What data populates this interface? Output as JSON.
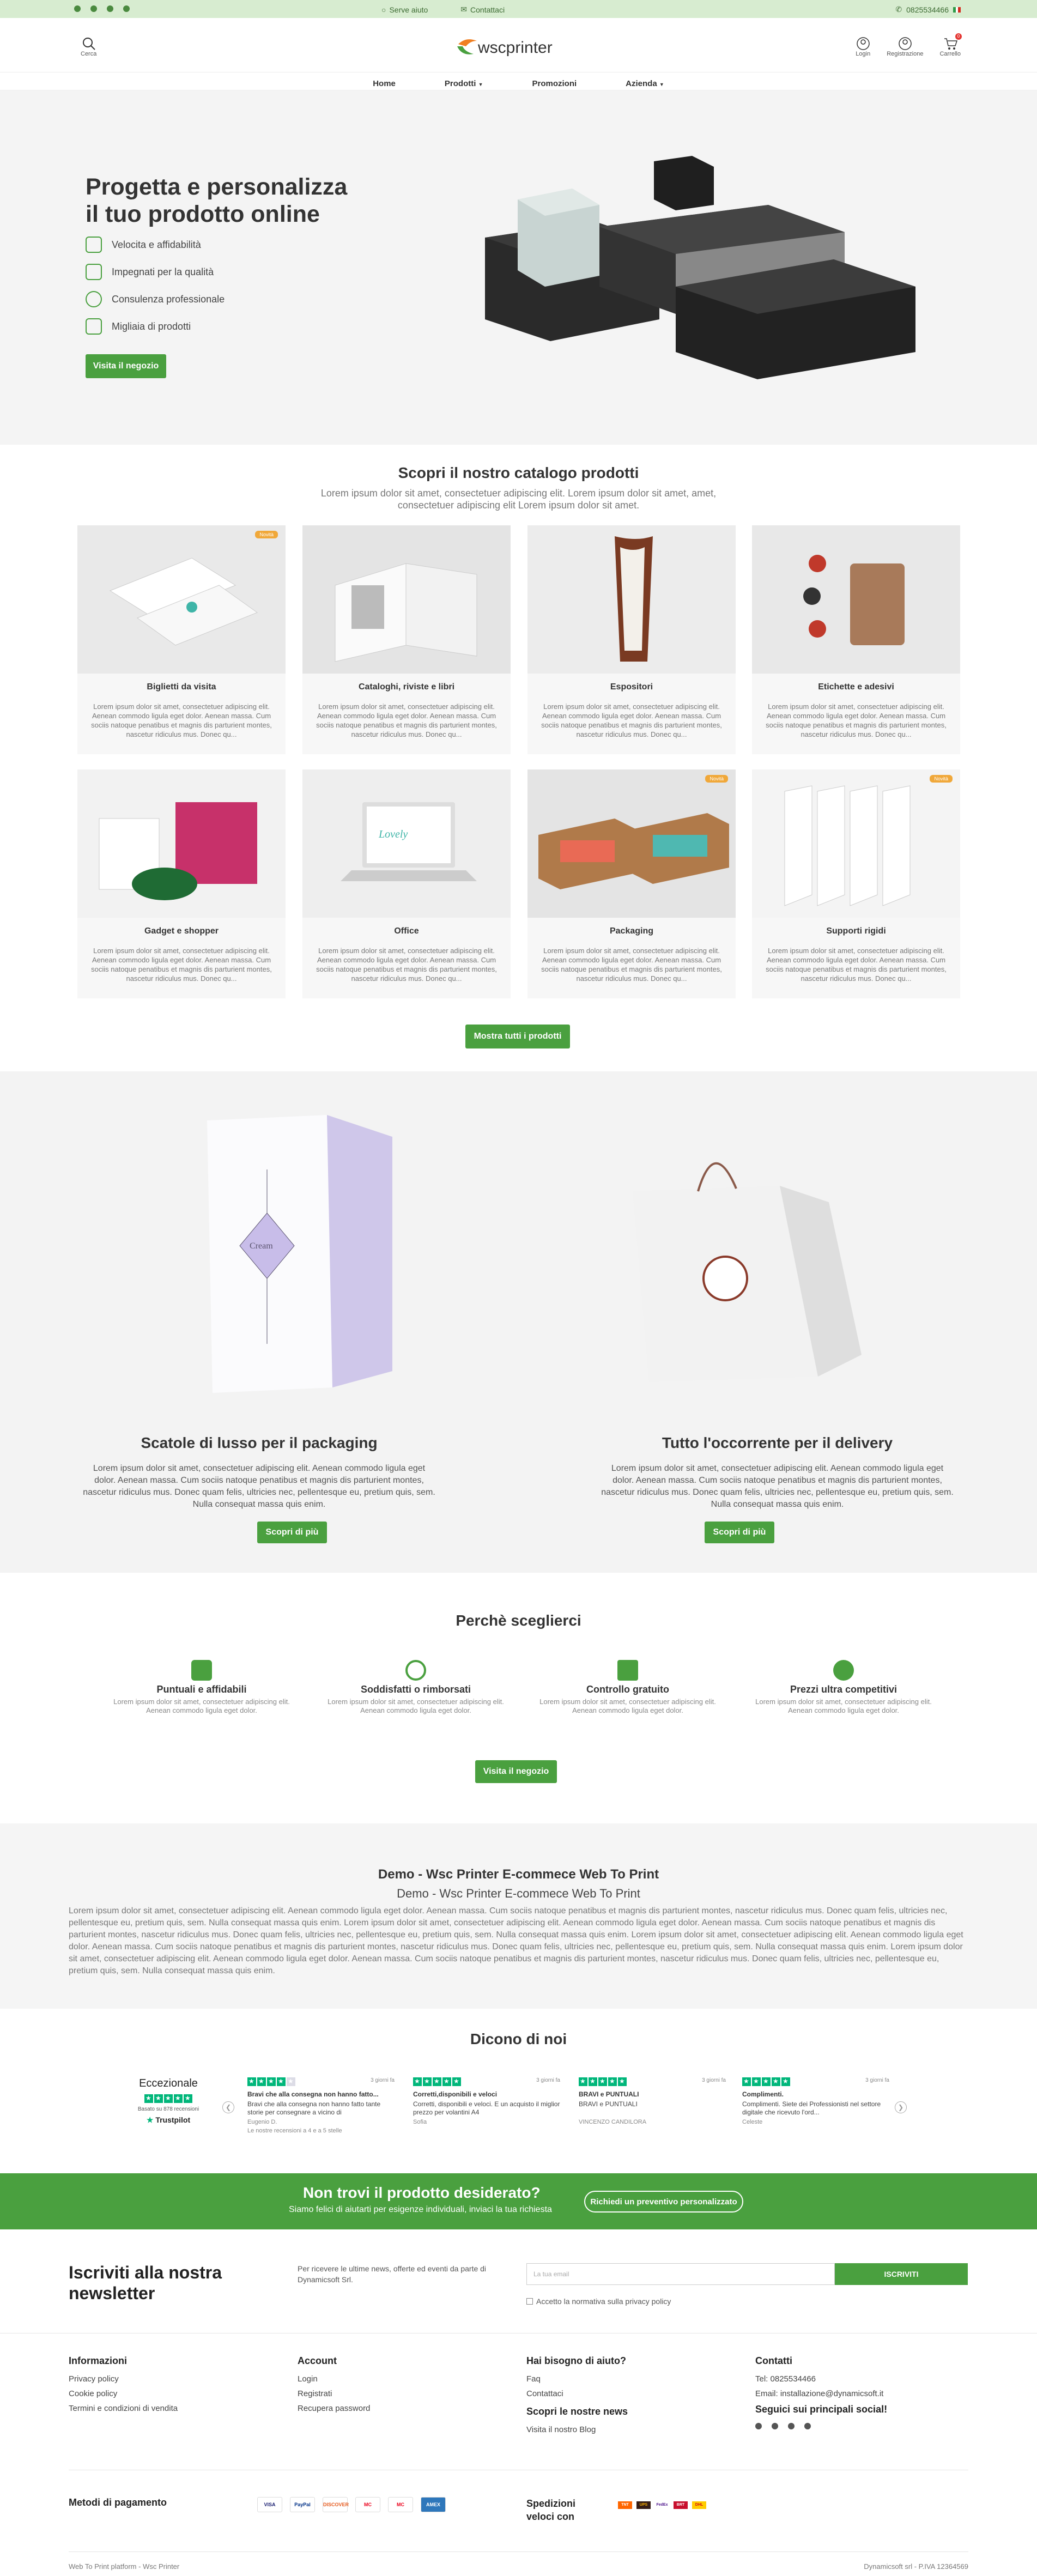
{
  "topbar": {
    "help": "Serve aiuto",
    "contacts": "Contattaci",
    "phone": "0825534466"
  },
  "header": {
    "search_label": "Cerca",
    "logo_text": "wscprinter",
    "login": "Login",
    "register": "Registrazione",
    "cart": "Carrello",
    "cart_count": "0"
  },
  "nav": [
    "Home",
    "Prodotti",
    "Promozioni",
    "Azienda"
  ],
  "hero": {
    "title_1": "Progetta e personalizza",
    "title_2": "il tuo prodotto online",
    "features": [
      "Velocita e affidabilità",
      "Impegnati per la qualità",
      "Consulenza professionale",
      "Migliaia di prodotti"
    ],
    "button": "Visita il negozio"
  },
  "catalog": {
    "title": "Scopri il nostro catalogo prodotti",
    "subtitle": "Lorem ipsum dolor sit amet, consectetuer adipiscing elit. Lorem ipsum dolor sit amet, amet, consectetuer adipiscing elit Lorem ipsum dolor sit amet.",
    "card_text": "Lorem ipsum dolor sit amet, consectetuer adipiscing elit. Aenean commodo ligula eget dolor. Aenean massa. Cum sociis natoque penatibus et magnis dis parturient montes, nascetur ridiculus mus. Donec qu...",
    "badge": "Novità",
    "items": [
      "Biglietti da visita",
      "Cataloghi, riviste e libri",
      "Espositori",
      "Etichette e adesivi",
      "Gadget e shopper",
      "Office",
      "Packaging",
      "Supporti rigidi"
    ],
    "show_all": "Mostra tutti i prodotti"
  },
  "promo": [
    {
      "title": "Scatole di lusso per il packaging",
      "text": "Lorem ipsum dolor sit amet, consectetuer adipiscing elit. Aenean commodo ligula eget dolor. Aenean massa. Cum sociis natoque penatibus et magnis dis parturient montes, nascetur ridiculus mus. Donec quam felis, ultricies nec, pellentesque eu, pretium quis, sem. Nulla consequat massa quis enim.",
      "button": "Scopri di più"
    },
    {
      "title": "Tutto l'occorrente per il delivery",
      "text": "Lorem ipsum dolor sit amet, consectetuer adipiscing elit. Aenean commodo ligula eget dolor. Aenean massa. Cum sociis natoque penatibus et magnis dis parturient montes, nascetur ridiculus mus. Donec quam felis, ultricies nec, pellentesque eu, pretium quis, sem. Nulla consequat massa quis enim.",
      "button": "Scopri di più"
    }
  ],
  "why": {
    "title": "Perchè sceglierci",
    "items": [
      {
        "title": "Puntuali e affidabili",
        "text": "Lorem ipsum dolor sit amet, consectetuer adipiscing elit. Aenean commodo ligula eget dolor."
      },
      {
        "title": "Soddisfatti o rimborsati",
        "text": "Lorem ipsum dolor sit amet, consectetuer adipiscing elit. Aenean commodo ligula eget dolor."
      },
      {
        "title": "Controllo gratuito",
        "text": "Lorem ipsum dolor sit amet, consectetuer adipiscing elit. Aenean commodo ligula eget dolor."
      },
      {
        "title": "Prezzi ultra competitivi",
        "text": "Lorem ipsum dolor sit amet, consectetuer adipiscing elit. Aenean commodo ligula eget dolor."
      }
    ],
    "button": "Visita il negozio"
  },
  "seo": {
    "title": "Demo - Wsc Printer E-commece Web To Print",
    "subtitle": "Demo - Wsc Printer E-commece Web To Print",
    "text": "Lorem ipsum dolor sit amet, consectetuer adipiscing elit. Aenean commodo ligula eget dolor. Aenean massa. Cum sociis natoque penatibus et magnis dis parturient montes, nascetur ridiculus mus. Donec quam felis, ultricies nec, pellentesque eu, pretium quis, sem. Nulla consequat massa quis enim. Lorem ipsum dolor sit amet, consectetuer adipiscing elit. Aenean commodo ligula eget dolor. Aenean massa. Cum sociis natoque penatibus et magnis dis parturient montes, nascetur ridiculus mus. Donec quam felis, ultricies nec, pellentesque eu, pretium quis, sem. Nulla consequat massa quis enim. Lorem ipsum dolor sit amet, consectetuer adipiscing elit. Aenean commodo ligula eget dolor. Aenean massa. Cum sociis natoque penatibus et magnis dis parturient montes, nascetur ridiculus mus. Donec quam felis, ultricies nec, pellentesque eu, pretium quis, sem. Nulla consequat massa quis enim. Lorem ipsum dolor sit amet, consectetuer adipiscing elit. Aenean commodo ligula eget dolor. Aenean massa. Cum sociis natoque penatibus et magnis dis parturient montes, nascetur ridiculus mus. Donec quam felis, ultricies nec, pellentesque eu, pretium quis, sem. Nulla consequat massa quis enim."
  },
  "reviews": {
    "title": "Dicono di noi",
    "summary_label": "Eccezionale",
    "summary_count": "Basato su 878 recensioni",
    "brand": "Trustpilot",
    "footnote": "Le nostre recensioni a 4 e a 5 stelle",
    "items": [
      {
        "date": "3 giorni fa",
        "title": "Bravi che alla consegna non hanno fatto...",
        "body": "Bravi che alla consegna non hanno fatto tante storie per consegnare a vicino di",
        "author": "Eugenio D.",
        "stars": 4
      },
      {
        "date": "3 giorni fa",
        "title": "Corretti,disponibili e veloci",
        "body": "Corretti, disponibili e veloci. E un acquisto il miglior prezzo per volantini A4",
        "author": "Sofia",
        "stars": 5
      },
      {
        "date": "3 giorni fa",
        "title": "BRAVI e PUNTUALI",
        "body": "BRAVI e PUNTUALI",
        "author": "VINCENZO CANDILORA",
        "stars": 5
      },
      {
        "date": "3 giorni fa",
        "title": "Complimenti.",
        "body": "Complimenti. Siete dei Professionisti nel settore digitale che ricevuto l'ord...",
        "author": "Celeste",
        "stars": 5
      }
    ]
  },
  "cta": {
    "title": "Non trovi il prodotto desiderato?",
    "text": "Siamo felici di aiutarti per esigenze individuali, inviaci la tua richiesta",
    "button": "Richiedi un preventivo personalizzato"
  },
  "newsletter": {
    "title": "Iscriviti alla nostra newsletter",
    "text": "Per ricevere le ultime news, offerte ed eventi da parte di Dynamicsoft Srl.",
    "placeholder": "La tua email",
    "button": "ISCRIVITI",
    "privacy": "Accetto la normativa sulla privacy policy"
  },
  "footer": {
    "info": {
      "title": "Informazioni",
      "links": [
        "Privacy policy",
        "Cookie policy",
        "Termini e condizioni di vendita"
      ]
    },
    "account": {
      "title": "Account",
      "links": [
        "Login",
        "Registrati",
        "Recupera password"
      ]
    },
    "help": {
      "title": "Hai bisogno di aiuto?",
      "links": [
        "Faq",
        "Contattaci"
      ]
    },
    "news": {
      "title": "Scopri le nostre news",
      "link": "Visita il nostro Blog"
    },
    "contacts": {
      "title": "Contatti",
      "phone": "Tel: 0825534466",
      "email": "Email: installazione@dynamicsoft.it"
    },
    "social_title": "Seguici sui principali social!",
    "payments_title": "Metodi di pagamento",
    "payments": [
      "VISA",
      "PayPal",
      "DISCOVER",
      "MC",
      "MC",
      "AMEX"
    ],
    "shipping_title_1": "Spedizioni",
    "shipping_title_2": "veloci con",
    "couriers": [
      "TNT",
      "UPS",
      "FedEx",
      "BRT",
      "DHL"
    ],
    "bottom_left": "Web To Print platform - Wsc Printer",
    "bottom_right": "Dynamicsoft srl - P.IVA 12364569"
  },
  "colors": {
    "accent": "#4aa03f",
    "topbar": "#d7ecd0",
    "badge": "#f0a83a",
    "trustpilot": "#00b67a"
  }
}
